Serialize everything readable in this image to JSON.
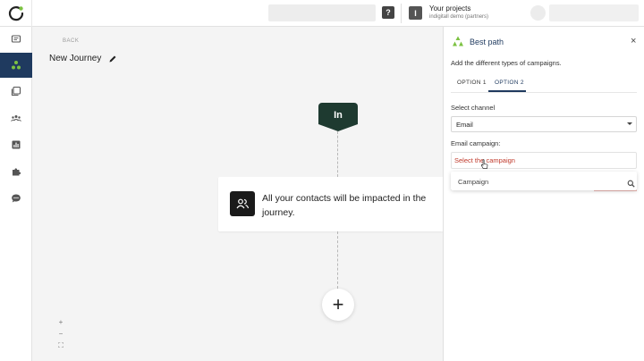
{
  "topbar": {
    "project_title": "Your projects",
    "project_subtitle": "indigitall demo (partners)",
    "project_badge": "I",
    "help_label": "?"
  },
  "sidebar": {
    "items": [
      {
        "icon": "chat-icon"
      },
      {
        "icon": "journey-icon",
        "active": true
      },
      {
        "icon": "campaigns-icon"
      },
      {
        "icon": "audience-icon"
      },
      {
        "icon": "stats-icon"
      },
      {
        "icon": "plugins-icon"
      },
      {
        "icon": "chat-bubble-icon"
      }
    ],
    "active_color": "#1f3a5f"
  },
  "canvas": {
    "back_label": "BACK",
    "journey_title": "New Journey",
    "in_node_label": "In",
    "in_node_color": "#1e3a30",
    "info_text": "All your contacts will be impacted in the journey.",
    "add_label": "+",
    "zoom_in": "+",
    "zoom_out": "−",
    "fit": "⛶"
  },
  "panel": {
    "title": "Best path",
    "close_label": "×",
    "description": "Add the different types of campaigns.",
    "tabs": [
      {
        "label": "OPTION 1",
        "selected": false
      },
      {
        "label": "OPTION 2",
        "selected": true
      }
    ],
    "channel_label": "Select channel",
    "channel_value": "Email",
    "campaign_label": "Email campaign:",
    "campaign_placeholder": "Select the campaign",
    "dropdown_search_placeholder": "Campaign",
    "accent_color": "#1f3a5f",
    "icon_color": "#7cc242"
  }
}
